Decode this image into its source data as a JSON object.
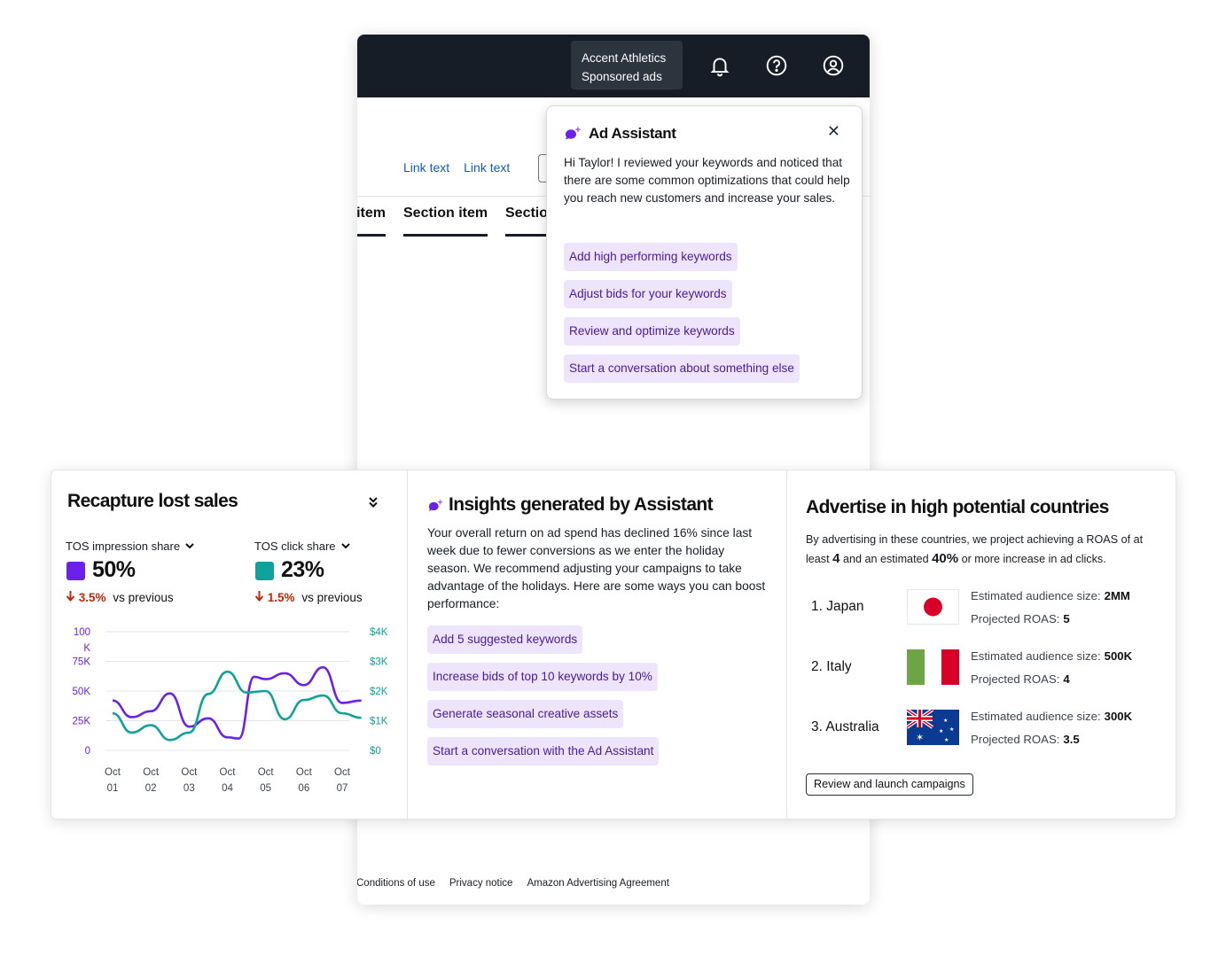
{
  "topbar": {
    "account_name": "Accent Athletics",
    "account_sub": "Sponsored ads",
    "icons": [
      "bell-icon",
      "help-icon",
      "account-icon"
    ]
  },
  "links": [
    "Link text",
    "Link text"
  ],
  "tabs": [
    "item",
    "Section item",
    "Sectio"
  ],
  "footer": [
    "Conditions of use",
    "Privacy notice",
    "Amazon Advertising Agreement"
  ],
  "assistant": {
    "title": "Ad Assistant",
    "message": "Hi Taylor! I reviewed your keywords and noticed that there are some common optimizations that could help you reach new customers and increase your sales.",
    "chips": [
      "Add high performing keywords",
      "Adjust bids for your keywords",
      "Review and optimize keywords",
      "Start a conversation about something else"
    ]
  },
  "recapture": {
    "title": "Recapture lost sales",
    "metric1": {
      "label": "TOS impression share",
      "value": "50%",
      "delta": "3.5%",
      "delta_text": "vs previous",
      "color": "#6b21e8"
    },
    "metric2": {
      "label": "TOS click share",
      "value": "23%",
      "delta": "1.5%",
      "delta_text": "vs previous",
      "color": "#0fa19a"
    }
  },
  "chart_data": {
    "type": "line",
    "categories": [
      "Oct 01",
      "Oct 02",
      "Oct 03",
      "Oct 04",
      "Oct 05",
      "Oct 06",
      "Oct 07"
    ],
    "x_ticks_top": [
      "Oct",
      "Oct",
      "Oct",
      "Oct",
      "Oct",
      "Oct",
      "Oct"
    ],
    "x_ticks_bottom": [
      "01",
      "02",
      "03",
      "04",
      "05",
      "06",
      "07"
    ],
    "y_left_ticks": [
      "100\nK",
      "75K",
      "50K",
      "25K",
      "0"
    ],
    "y_right_ticks": [
      "$4K",
      "$3K",
      "$2K",
      "$1K",
      "$0"
    ],
    "ylim_left": [
      0,
      100000
    ],
    "ylim_right": [
      0,
      4000
    ],
    "grid": true,
    "series": [
      {
        "axis": "left",
        "color": "#6b21e8",
        "x": [
          0,
          0.5,
          1,
          1.5,
          2,
          2.5,
          3,
          3.3,
          3.7,
          4,
          4.5,
          5,
          5.5,
          6,
          6.5
        ],
        "values": [
          42000,
          28000,
          33000,
          48000,
          20000,
          27000,
          11000,
          10000,
          62000,
          60000,
          65000,
          55000,
          70000,
          40000,
          42000
        ]
      },
      {
        "axis": "right",
        "color": "#0fa19a",
        "x": [
          0,
          0.5,
          1,
          1.5,
          2,
          2.5,
          3,
          3.5,
          4,
          4.5,
          5,
          5.5,
          6,
          6.5
        ],
        "values": [
          1250,
          600,
          850,
          350,
          600,
          1900,
          2650,
          1950,
          2000,
          1050,
          1700,
          1850,
          1250,
          1100
        ]
      }
    ]
  },
  "insights": {
    "title": "Insights generated by Assistant",
    "message": "Your overall return on ad spend has declined 16% since last week due to fewer conversions as we enter the holiday season. We recommend adjusting your campaigns to take advantage of the holidays. Here are some ways you can boost performance:",
    "chips": [
      "Add 5 suggested keywords",
      "Increase bids of top 10 keywords by 10%",
      "Generate seasonal creative assets",
      "Start a conversation with the Ad Assistant"
    ]
  },
  "countries": {
    "title": "Advertise in high potential countries",
    "msg_pre": "By advertising in these countries, we project achieving a ROAS of at least",
    "msg_roas": "4",
    "msg_mid": "and an estimated",
    "msg_pct": "40%",
    "msg_post": "or more increase in ad clicks.",
    "audience_label": "Estimated audience size:",
    "roas_label": "Projected ROAS:",
    "items": [
      {
        "name": "1. Japan",
        "audience": "2MM",
        "roas": "5",
        "flag": "japan-flag-icon"
      },
      {
        "name": "2. Italy",
        "audience": "500K",
        "roas": "4",
        "flag": "italy-flag-icon"
      },
      {
        "name": "3. Australia",
        "audience": "300K",
        "roas": "3.5",
        "flag": "australia-flag-icon"
      }
    ],
    "button": "Review and launch campaigns"
  }
}
